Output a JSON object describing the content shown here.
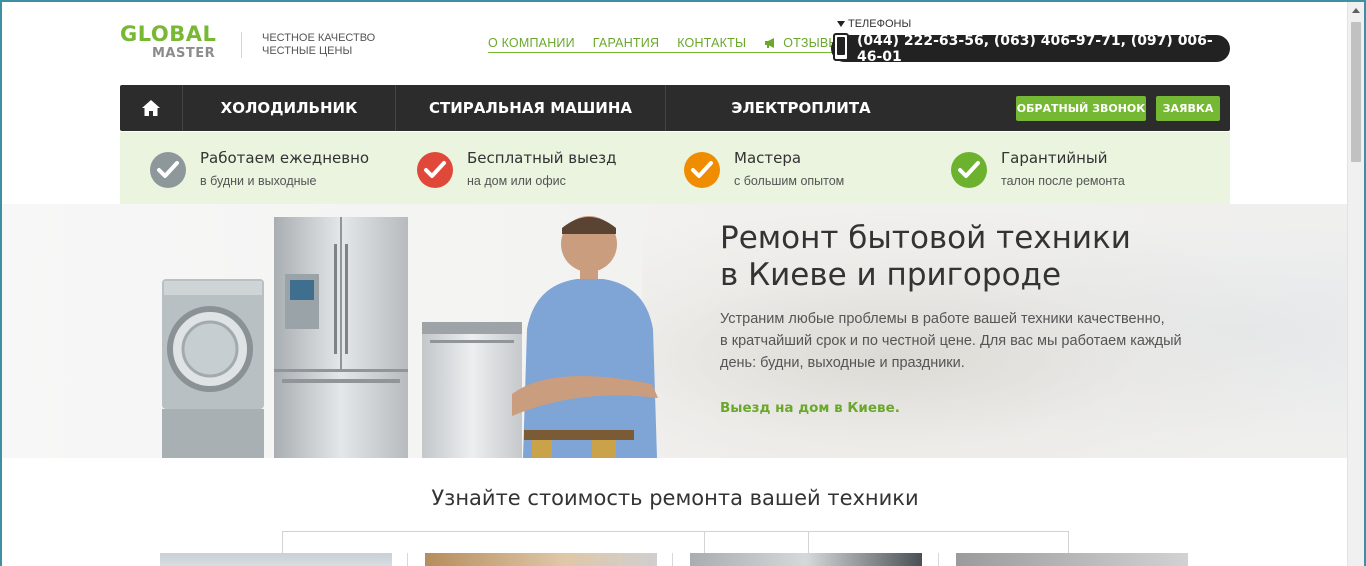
{
  "logo": {
    "line1": "GLOBAL",
    "line2": "MASTER"
  },
  "tagline": {
    "line1": "ЧЕСТНОЕ КАЧЕСТВО",
    "line2": "ЧЕСТНЫЕ ЦЕНЫ"
  },
  "topnav": {
    "about": "О КОМПАНИИ",
    "warranty": "ГАРАНТИЯ",
    "contacts": "КОНТАКТЫ",
    "reviews": "ОТЗЫВЫ"
  },
  "phones": {
    "label": "ТЕЛЕФОНЫ",
    "numbers": "(044) 222-63-56, (063) 406-97-71, (097) 006-46-01"
  },
  "mainnav": {
    "items": [
      "ХОЛОДИЛЬНИК",
      "СТИРАЛЬНАЯ МАШИНА",
      "ЭЛЕКТРОПЛИТА"
    ],
    "callback": "ОБРАТНЫЙ ЗВОНОК",
    "request": "ЗАЯВКА"
  },
  "features": [
    {
      "title": "Работаем ежедневно",
      "sub": "в будни и выходные",
      "color": "#8e979a"
    },
    {
      "title": "Бесплатный выезд",
      "sub": "на дом или офис",
      "color": "#e0483a"
    },
    {
      "title": "Мастера",
      "sub": "с большим опытом",
      "color": "#f08c00"
    },
    {
      "title": "Гарантийный",
      "sub": "талон после ремонта",
      "color": "#6db22e"
    }
  ],
  "hero": {
    "title_line1": "Ремонт бытовой техники",
    "title_line2": "в Киеве и пригороде",
    "desc_line1": "Устраним любые проблемы в работе вашей техники качественно,",
    "desc_line2": "в кратчайший срок и по честной цене. Для вас мы работаем каждый",
    "desc_line3": "день: будни, выходные и праздники.",
    "cta": "Выезд на дом в Киеве."
  },
  "section": {
    "title": "Узнайте стоимость ремонта вашей техники"
  },
  "colors": {
    "accent": "#75b833",
    "dark": "#2c2c2c",
    "feature_bg": "#eaf4df"
  }
}
